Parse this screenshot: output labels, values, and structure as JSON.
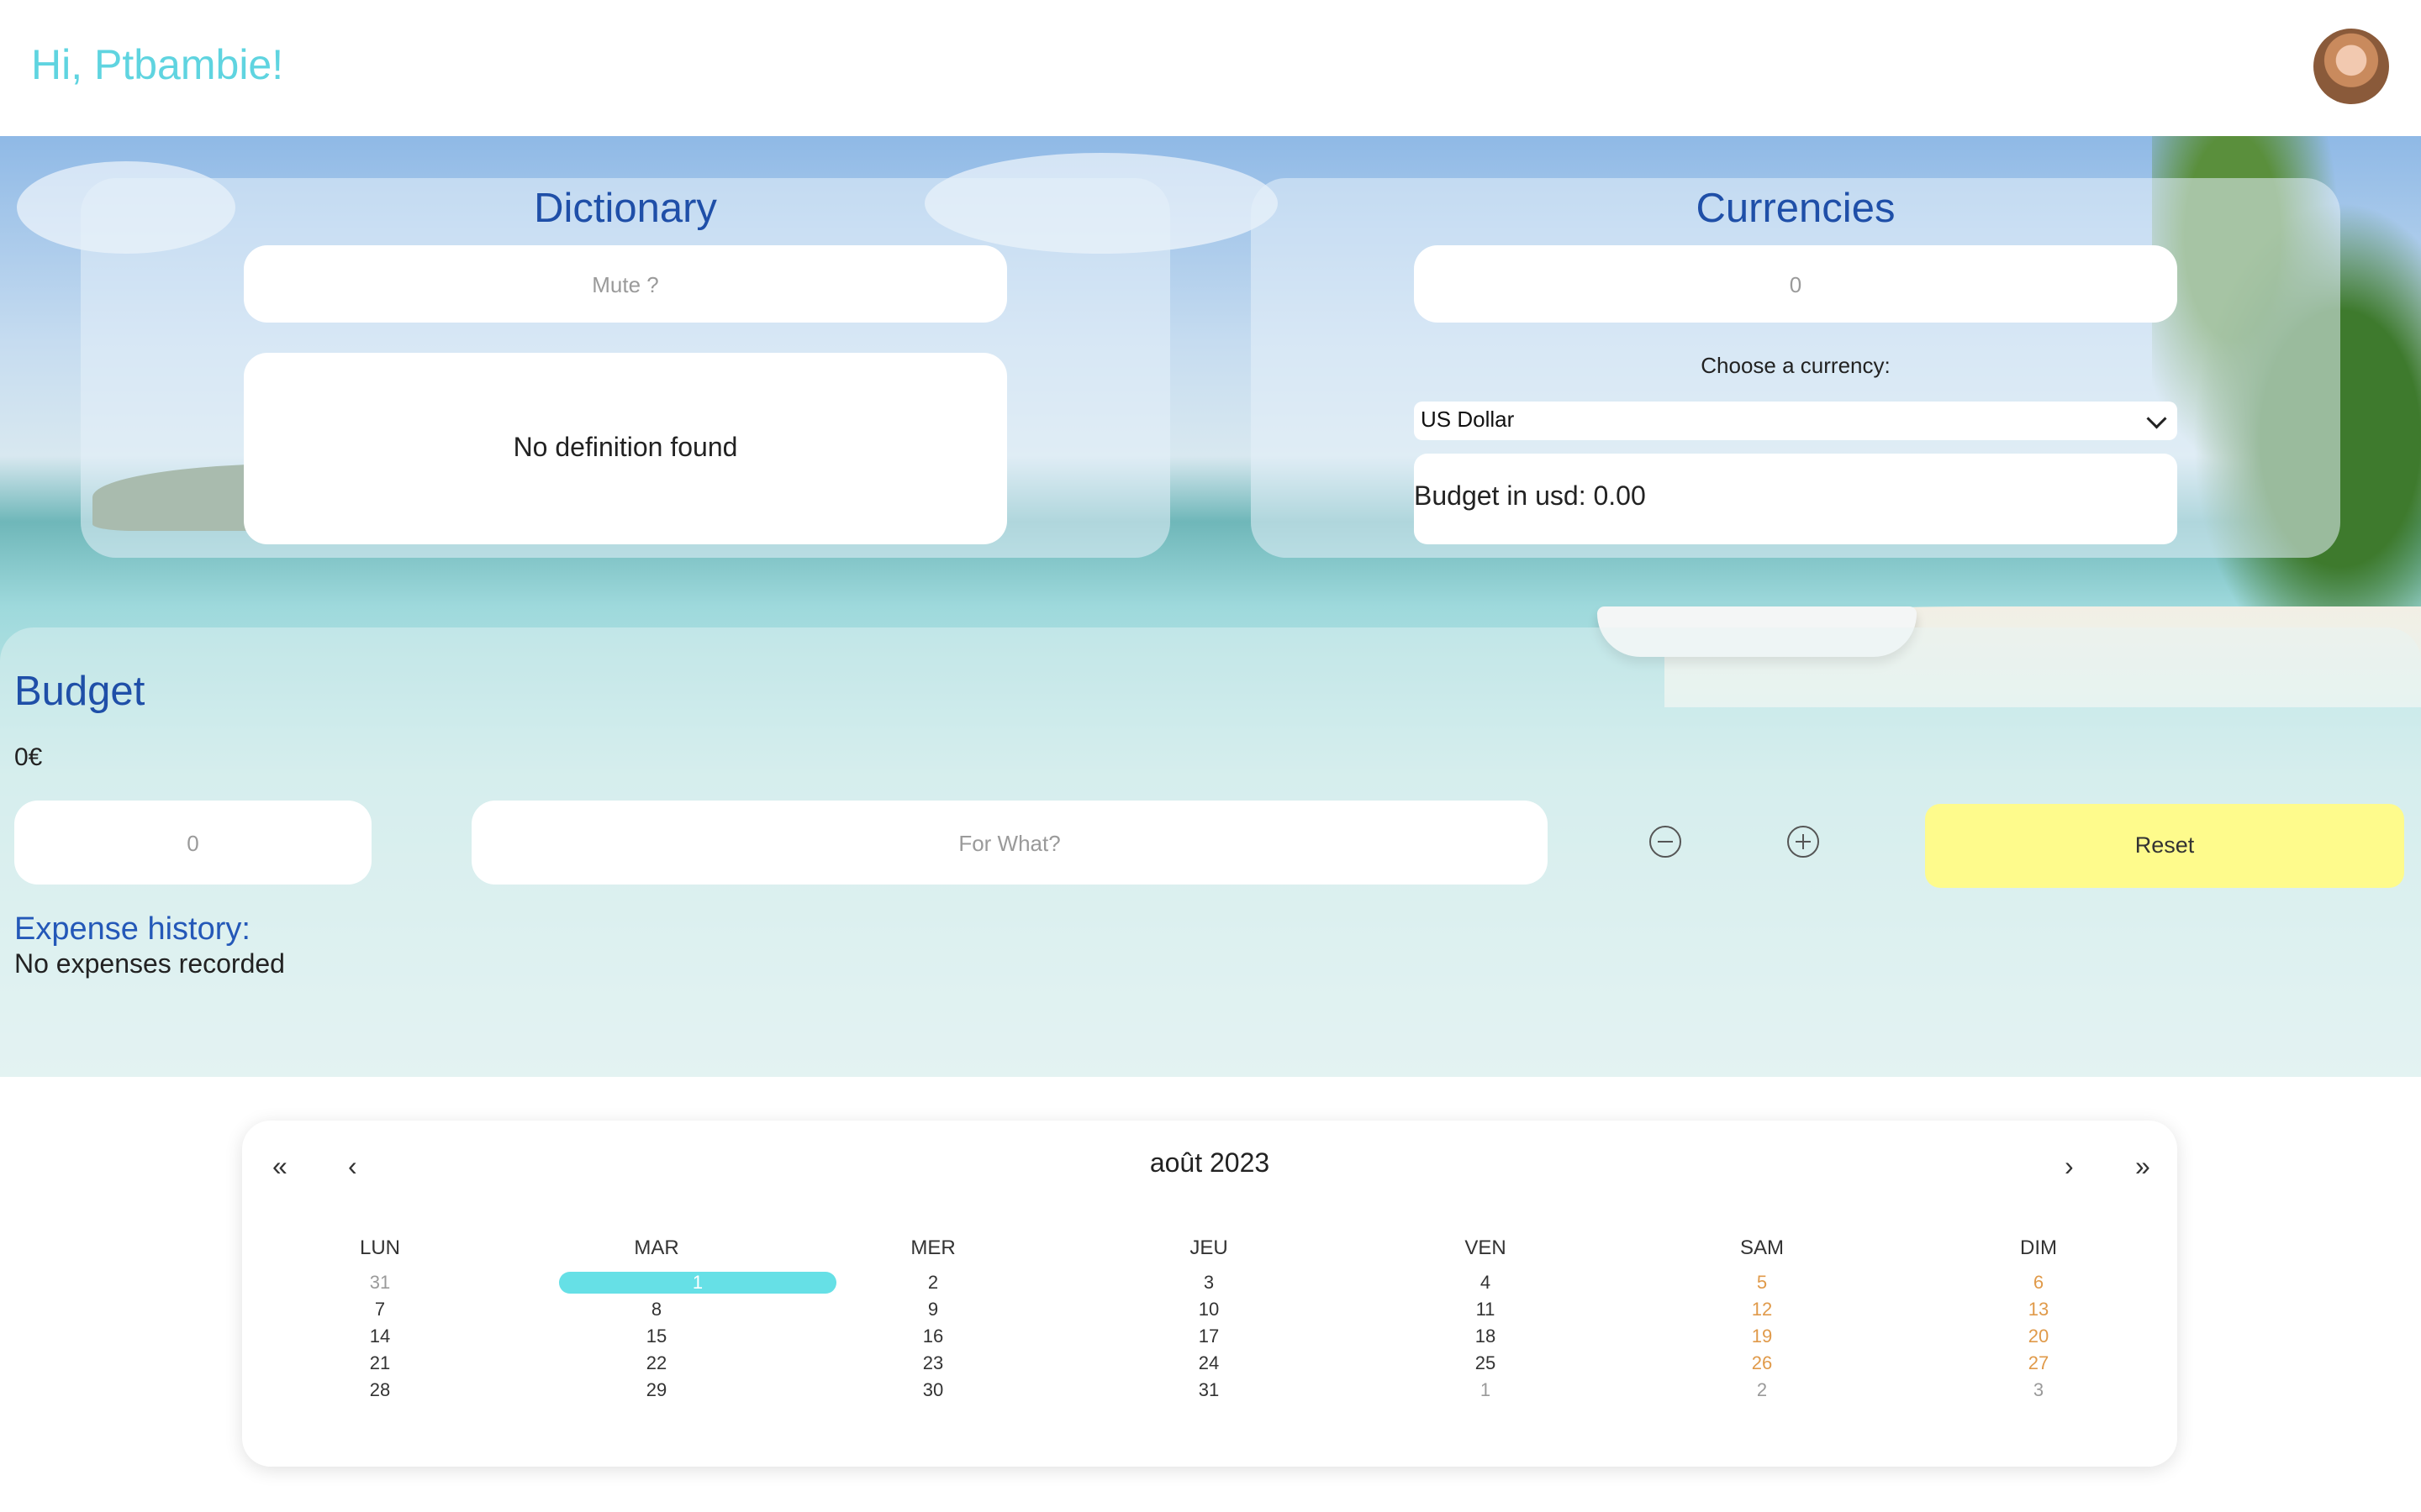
{
  "header": {
    "greeting": "Hi, Ptbambie!"
  },
  "dictionary": {
    "title": "Dictionary",
    "search_placeholder": "Mute ?",
    "definition": "No definition found"
  },
  "currencies": {
    "title": "Currencies",
    "amount_value": "0",
    "choose_label": "Choose a currency:",
    "selected_currency": "US Dollar",
    "result": "Budget in usd: 0.00"
  },
  "budget": {
    "title": "Budget",
    "amount": "0€",
    "amount_input_value": "0",
    "purpose_placeholder": "For What?",
    "reset_label": "Reset",
    "history_title": "Expense history:",
    "history_empty": "No expenses recorded"
  },
  "calendar": {
    "month_label": "août 2023",
    "nav_first": "«",
    "nav_prev": "‹",
    "nav_next": "›",
    "nav_last": "»",
    "weekdays": [
      "LUN",
      "MAR",
      "MER",
      "JEU",
      "VEN",
      "SAM",
      "DIM"
    ],
    "weeks": [
      [
        "31",
        "1",
        "2",
        "3",
        "4",
        "5",
        "6"
      ],
      [
        "7",
        "8",
        "9",
        "10",
        "11",
        "12",
        "13"
      ],
      [
        "14",
        "15",
        "16",
        "17",
        "18",
        "19",
        "20"
      ],
      [
        "21",
        "22",
        "23",
        "24",
        "25",
        "26",
        "27"
      ],
      [
        "28",
        "29",
        "30",
        "31",
        "1",
        "2",
        "3"
      ]
    ],
    "selected_day": "1"
  },
  "colors": {
    "accent": "#5fd4e0",
    "title_blue": "#1f4fa8",
    "reset_yellow": "#fefb8c",
    "weekend_orange": "#e09a4a"
  },
  "icons": {
    "minus": "minus-circle-icon",
    "plus": "plus-circle-icon",
    "chevron": "chevron-down-icon"
  }
}
